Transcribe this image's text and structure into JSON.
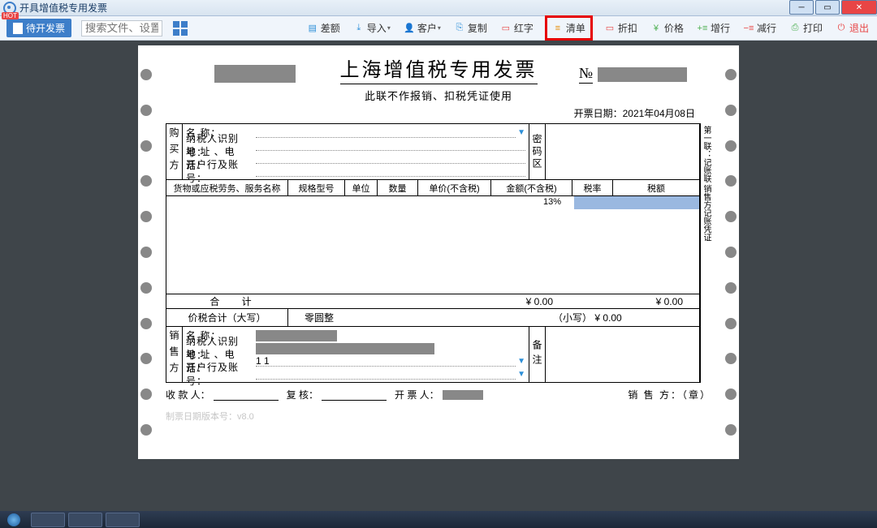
{
  "window": {
    "title": "开具增值税专用发票"
  },
  "toolbar": {
    "pending": "待开发票",
    "placeholder": "搜索文件、设置等内容",
    "btns": {
      "chae": "差额",
      "daoru": "导入",
      "kehu": "客户",
      "fuzhi": "复制",
      "hongzi": "红字",
      "qingdan": "清单",
      "zhekou": "折扣",
      "jiage": "价格",
      "zenghang": "增行",
      "jianhang": "减行",
      "dayin": "打印",
      "tuichu": "退出"
    }
  },
  "invoice": {
    "title": "上海增值税专用发票",
    "sub_note": "此联不作报销、扣税凭证使用",
    "no_label": "№",
    "issue_date_label": "开票日期：",
    "issue_date": "2021年04月08日",
    "buyer_label": "购买方",
    "pw_label": "密码区",
    "seller_label": "销售方",
    "remark_label": "备注",
    "fields": {
      "name": "名        称：",
      "taxid": "纳税人识别号：",
      "addr": "地 址 、电 话：",
      "bank": "开户行及账号："
    },
    "cols": {
      "name": "货物或应税劳务、服务名称",
      "spec": "规格型号",
      "unit": "单位",
      "qty": "数量",
      "price": "单价(不含税)",
      "amt": "金额(不含税)",
      "rate": "税率",
      "tax": "税额"
    },
    "row1_rate": "13%",
    "side_note": "第一联：记账联 销售方记账凭证",
    "total_label": "合    计",
    "total_amt": "¥ 0.00",
    "total_tax": "¥ 0.00",
    "hj_label": "价税合计（大写）",
    "hj_cap": "零圆整",
    "hj_xiao_label": "（小写）",
    "hj_xiao": "¥ 0.00",
    "seller_addr_val": "1 1",
    "foot": {
      "payee": "收 款 人：",
      "checker": "复 核：",
      "drawer": "开 票 人：",
      "stamp": "销  售  方：（章）"
    },
    "version": "制票日期版本号：v8.0"
  }
}
